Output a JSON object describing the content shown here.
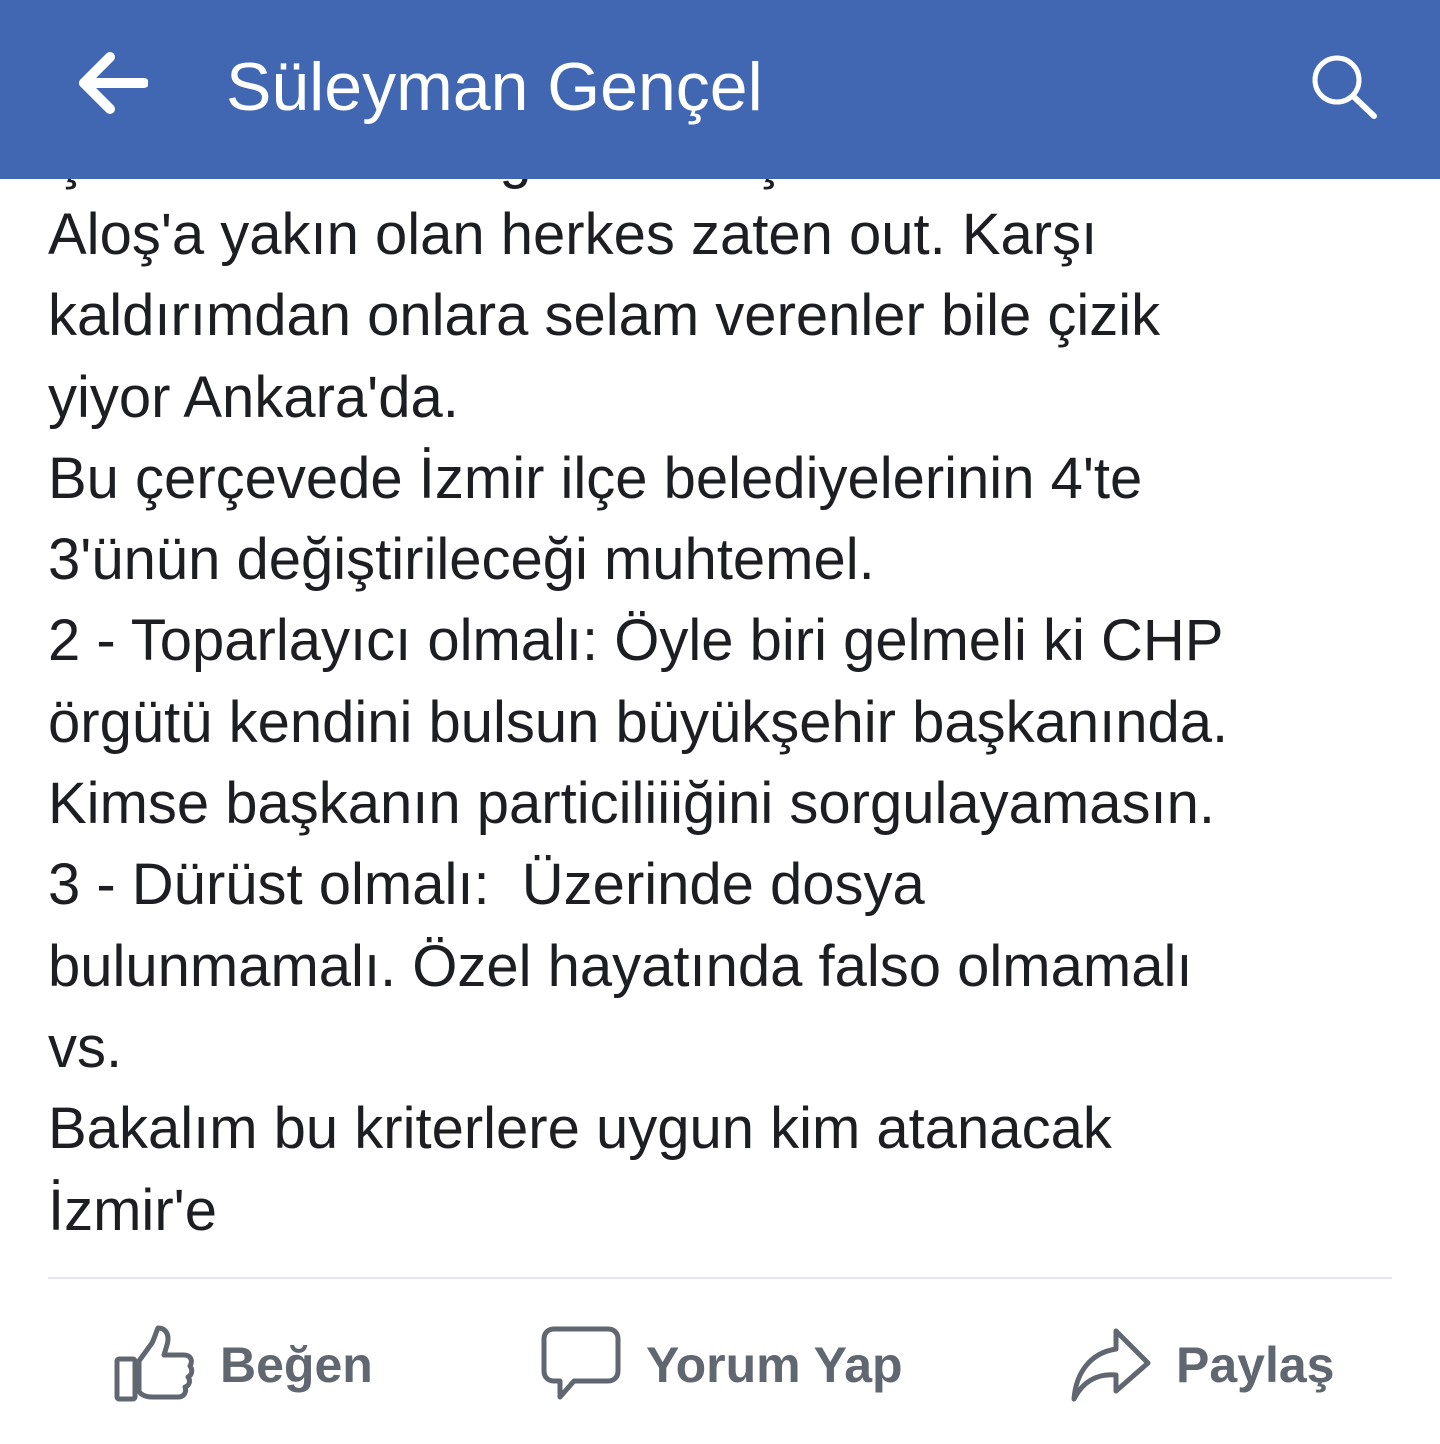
{
  "header": {
    "title": "Süleyman Gençel",
    "back_icon": "arrow-left-icon",
    "search_icon": "search-icon",
    "background_color": "#4267b2"
  },
  "post": {
    "clipped_top_line": "Çünkü bu bakanlığın tek başına…",
    "text": "Aloş'a yakın olan herkes zaten out. Karşı\nkaldırımdan onlara selam verenler bile çizik\nyiyor Ankara'da.\nBu çerçevede İzmir ilçe belediyelerinin 4'te\n3'ünün değiştirileceği muhtemel.\n2 - Toparlayıcı olmalı: Öyle biri gelmeli ki CHP\nörgütü kendini bulsun büyükşehir başkanında.\nKimse başkanın particiliiiğini sorgulayamasın.\n3 - Dürüst olmalı:  Üzerinde dosya\nbulunmamalı. Özel hayatında falso olmamalı\nvs.\nBakalım bu kriterlere uygun kim atanacak\nİzmir'e"
  },
  "actions": {
    "like_label": "Beğen",
    "comment_label": "Yorum Yap",
    "share_label": "Paylaş",
    "like_icon": "thumbs-up-icon",
    "comment_icon": "speech-bubble-icon",
    "share_icon": "share-arrow-icon",
    "color": "#606770"
  }
}
